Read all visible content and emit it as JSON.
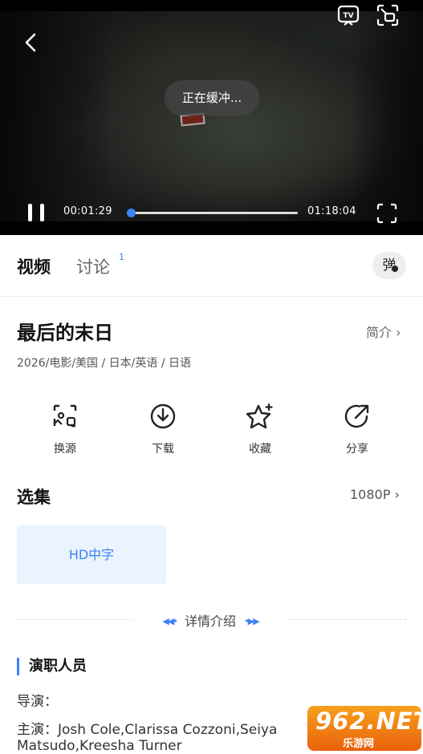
{
  "player": {
    "buffering_text": "正在缓冲...",
    "current_time": "00:01:29",
    "total_time": "01:18:04",
    "progress_fraction": 0.02,
    "icons": {
      "back": "back-arrow-icon",
      "tv": "tv-cast-icon",
      "pip": "picture-in-picture-icon",
      "pause": "pause-icon",
      "fullscreen": "fullscreen-icon"
    }
  },
  "tabs": [
    {
      "label": "视频",
      "active": true
    },
    {
      "label": "讨论",
      "badge": "1",
      "active": false
    }
  ],
  "danmu_label": "弹",
  "movie": {
    "title": "最后的末日",
    "intro_link": "简介",
    "meta": "2026/电影/美国 / 日本/英语 / 日语"
  },
  "actions": [
    {
      "label": "换源",
      "icon": "switch-source-icon"
    },
    {
      "label": "下载",
      "icon": "download-icon"
    },
    {
      "label": "收藏",
      "icon": "star-icon"
    },
    {
      "label": "分享",
      "icon": "share-icon"
    }
  ],
  "episodes": {
    "title": "选集",
    "quality": "1080P",
    "items": [
      "HD中字"
    ]
  },
  "detail_divider": "详情介绍",
  "cast": {
    "title": "演职人员",
    "director_label": "导演：",
    "actors_line1": "主演：Josh Cole,Clarissa Cozzoni,Seiya",
    "actors_line2": "Matsudo,Kreesha Turner"
  },
  "watermark": {
    "big": "962.NET",
    "small": "乐游网"
  },
  "colors": {
    "accent": "#3b82f6",
    "episode_bg": "#eaf3fe"
  }
}
